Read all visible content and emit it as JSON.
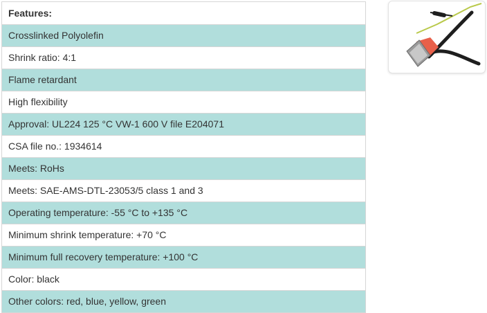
{
  "features": {
    "heading": "Features:",
    "rows": [
      {
        "text": "Crosslinked Polyolefin"
      },
      {
        "text": "Shrink ratio: 4:1"
      },
      {
        "text": "Flame retardant"
      },
      {
        "text": "High flexibility"
      },
      {
        "text": "Approval: UL224 125 °C VW-1 600 V file E204071"
      },
      {
        "text": "CSA file no.: 1934614"
      },
      {
        "text": "Meets: RoHs"
      },
      {
        "text": "Meets: SAE-AMS-DTL-23053/5 class 1 and 3"
      },
      {
        "text": "Operating temperature: -55 °C to +135 °C"
      },
      {
        "text": "Minimum shrink temperature: +70 °C"
      },
      {
        "text": "Minimum full recovery temperature: +100 °C"
      },
      {
        "text": "Color: black"
      },
      {
        "text": "Other colors: red, blue, yellow, green"
      }
    ]
  },
  "colors": {
    "row_alt": "#b1dedc",
    "border": "#d6d6d6",
    "connector": "#e8604a"
  },
  "product_image": {
    "icon": "cable-connector-image"
  }
}
